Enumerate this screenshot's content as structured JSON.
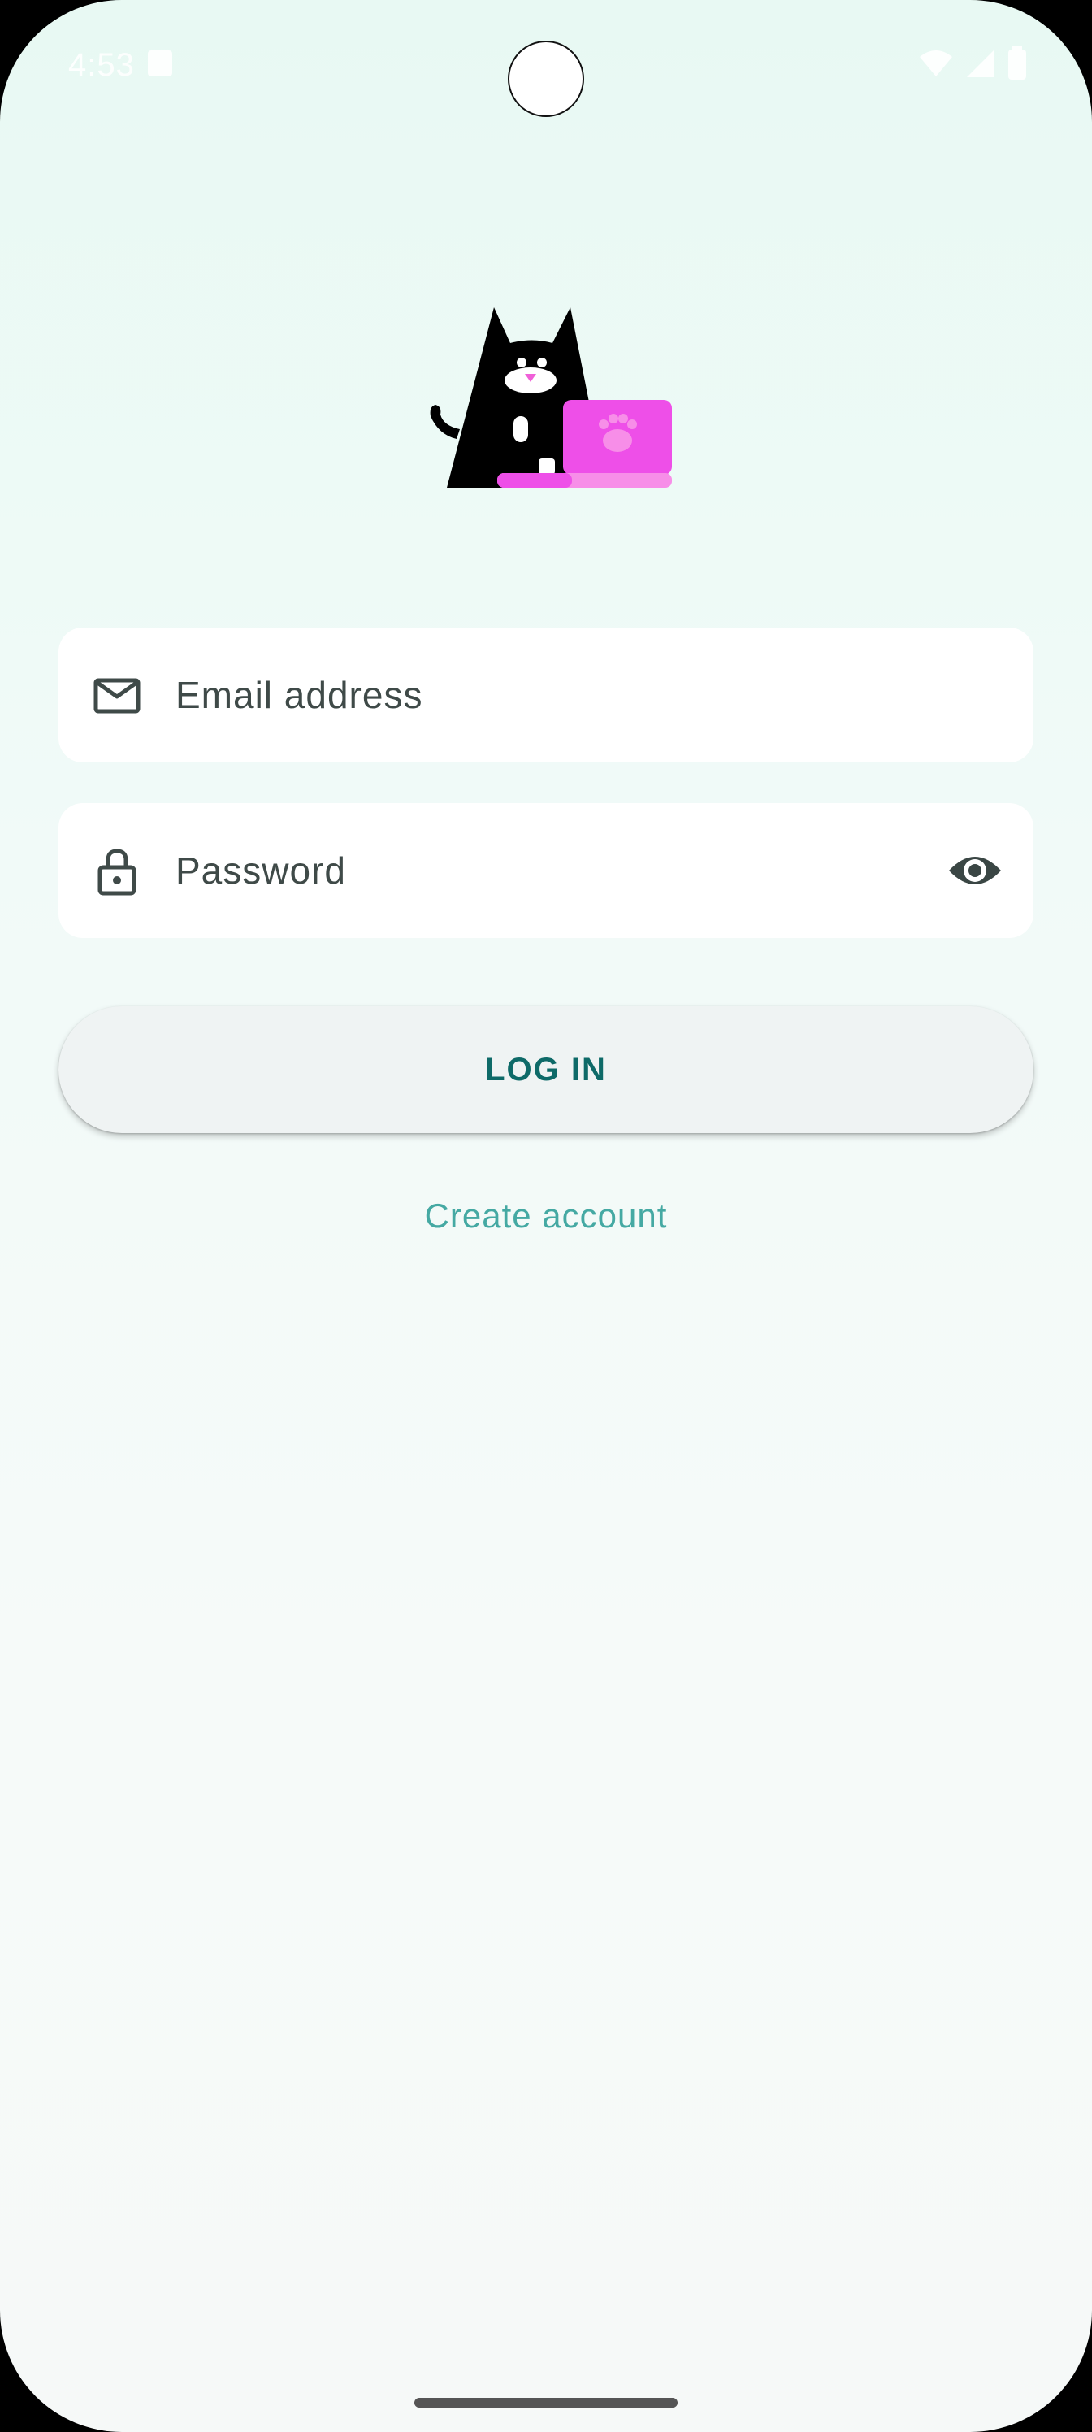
{
  "status_bar": {
    "time": "4:53",
    "icons": [
      "notification-icon",
      "wifi-icon",
      "signal-icon",
      "battery-icon"
    ]
  },
  "logo": {
    "name": "cat-with-laptop-logo",
    "colors": {
      "cat": "#000000",
      "laptop": "#ee4fe8",
      "laptop_base": "#f78ee8",
      "nose": "#f060d8"
    }
  },
  "email": {
    "icon": "mail-icon",
    "placeholder": "Email address",
    "value": ""
  },
  "password": {
    "icon": "lock-icon",
    "placeholder": "Password",
    "value": "",
    "toggle_icon": "eye-icon"
  },
  "login_button": {
    "label": "LOG IN"
  },
  "create_account": {
    "label": "Create account"
  },
  "colors": {
    "accent": "#0e6a68",
    "link": "#45a9a3",
    "background_top": "#e8f9f3",
    "background_bottom": "#f6f9f8",
    "field_background": "#ffffff",
    "button_background": "#eff3f3"
  }
}
